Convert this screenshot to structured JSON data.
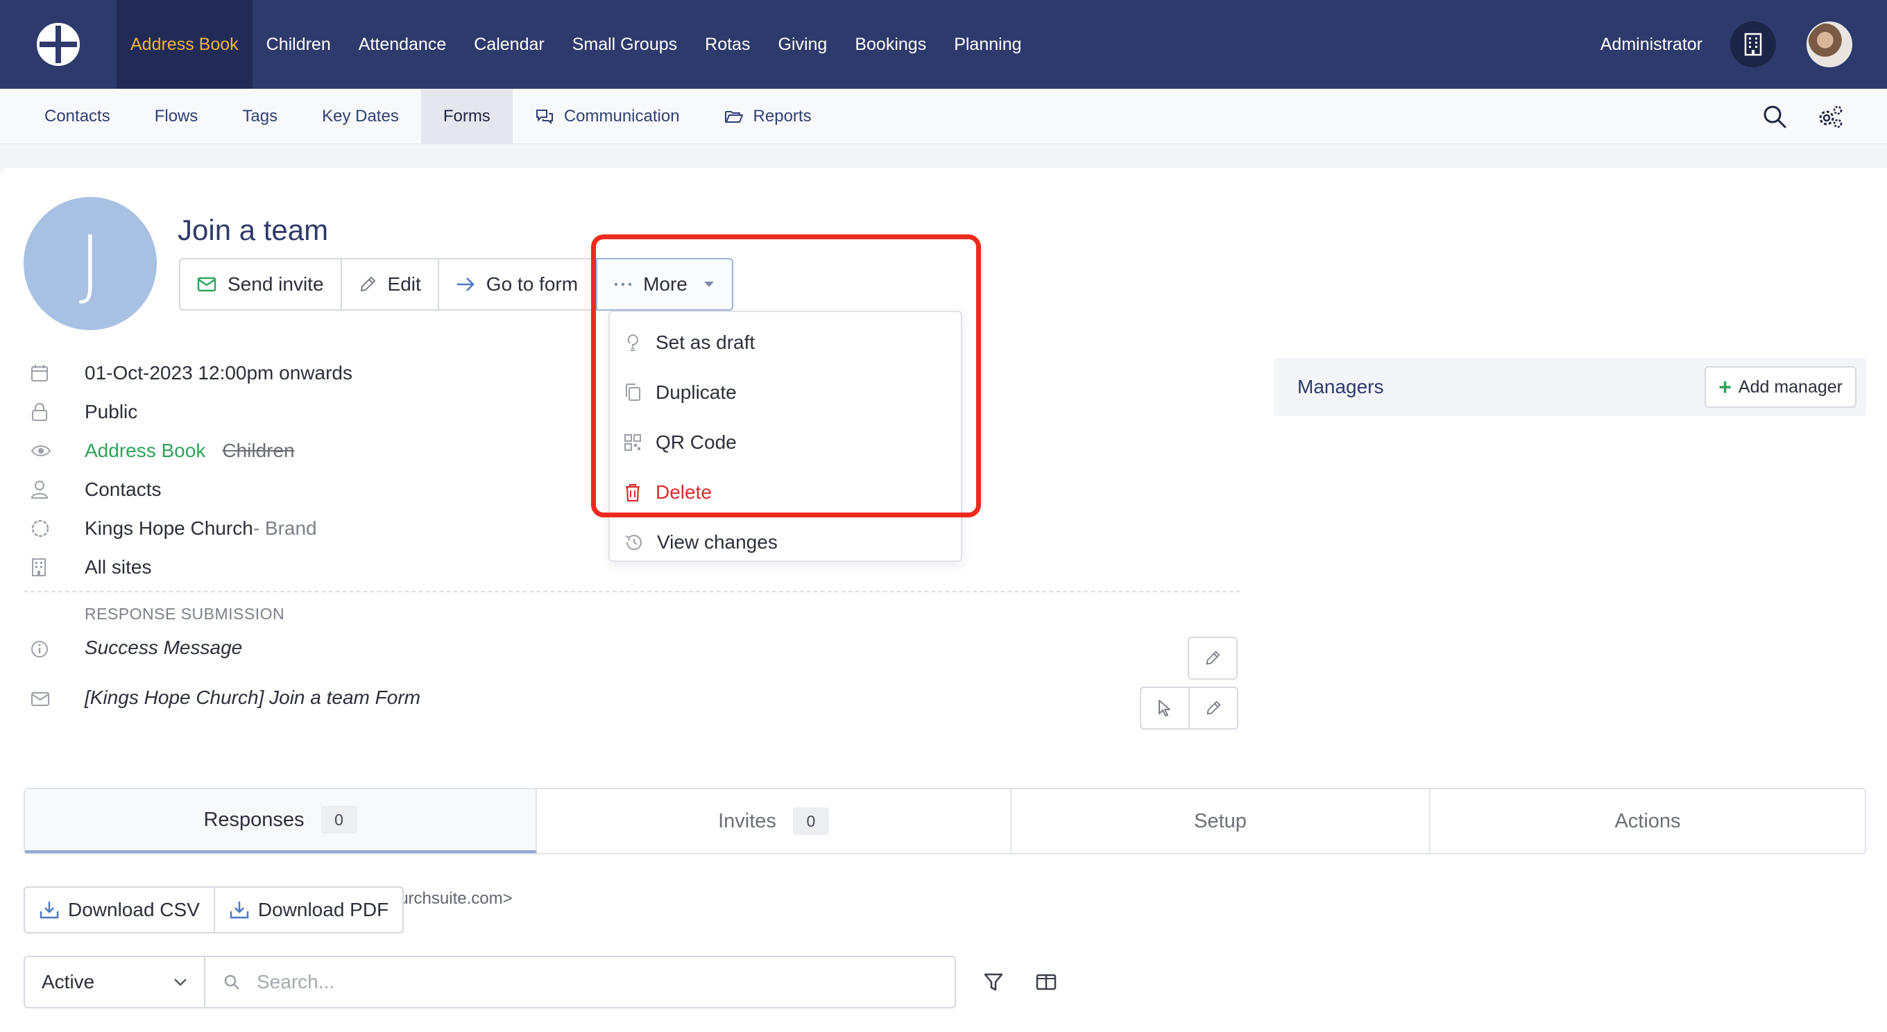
{
  "topnav": {
    "items": [
      {
        "label": "Address Book",
        "active": true
      },
      {
        "label": "Children"
      },
      {
        "label": "Attendance"
      },
      {
        "label": "Calendar"
      },
      {
        "label": "Small Groups"
      },
      {
        "label": "Rotas"
      },
      {
        "label": "Giving"
      },
      {
        "label": "Bookings"
      },
      {
        "label": "Planning"
      }
    ],
    "user_label": "Administrator",
    "accent": "#f0b43a",
    "background": "#2e3a6b"
  },
  "subnav": {
    "items": [
      {
        "label": "Contacts"
      },
      {
        "label": "Flows"
      },
      {
        "label": "Tags"
      },
      {
        "label": "Key Dates"
      },
      {
        "label": "Forms",
        "active": true
      },
      {
        "label": "Communication",
        "icon": "chat-bubbles-icon"
      },
      {
        "label": "Reports",
        "icon": "folder-open-icon"
      }
    ]
  },
  "form": {
    "avatar_initial": "J",
    "title": "Join a team",
    "actions": {
      "send_invite": "Send invite",
      "edit": "Edit",
      "go_to_form": "Go to form",
      "more": "More"
    },
    "more_menu": [
      {
        "label": "Set as draft",
        "icon": "draft-icon"
      },
      {
        "label": "Duplicate",
        "icon": "duplicate-icon"
      },
      {
        "label": "QR Code",
        "icon": "qr-code-icon"
      },
      {
        "label": "Delete",
        "icon": "trash-icon",
        "color": "#d92c2c"
      },
      {
        "label": "View changes",
        "icon": "history-icon"
      }
    ],
    "details": {
      "date": "01-Oct-2023 12:00pm onwards",
      "visibility": "Public",
      "modules_active": "Address Book",
      "modules_inactive": "Children",
      "audience": "Contacts",
      "brand_name": "Kings Hope Church",
      "brand_suffix": " - Brand",
      "sites": "All sites"
    },
    "response_submission": {
      "label": "RESPONSE SUBMISSION",
      "success_message": "Success Message",
      "email_subject": "[Kings Hope Church] Join a team Form",
      "email_from": "Kings Hope Church Forms   <no-reply@churchsuite.com>"
    }
  },
  "managers": {
    "title": "Managers",
    "add_label": "Add manager"
  },
  "tabs": [
    {
      "label": "Responses",
      "count": "0",
      "active": true
    },
    {
      "label": "Invites",
      "count": "0"
    },
    {
      "label": "Setup"
    },
    {
      "label": "Actions"
    }
  ],
  "downloads": {
    "csv": "Download CSV",
    "pdf": "Download PDF"
  },
  "filter": {
    "status": "Active",
    "search_placeholder": "Search..."
  },
  "highlight_color": "#ee2a1f"
}
